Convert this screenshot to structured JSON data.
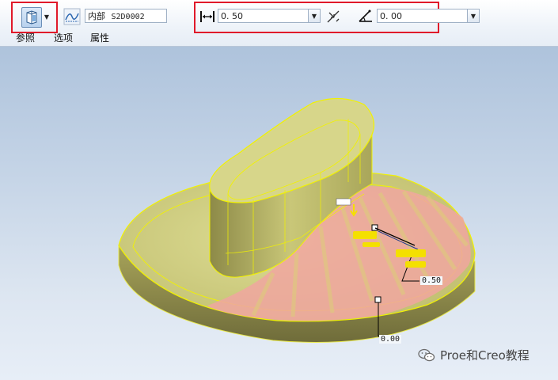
{
  "toolbar": {
    "feature_type_icon": "sweep-blend-surface-icon",
    "section_icon": "sketch-curve-icon",
    "section_combo": {
      "prefix": "内部",
      "name": "S2D0002"
    },
    "thickness_icon": "thickness-dimension-icon",
    "thickness_value": "0. 50",
    "flip_icon": "flip-direction-icon",
    "angle_icon": "angle-icon",
    "angle_value": "0. 00"
  },
  "tabs": [
    "参照",
    "选项",
    "属性"
  ],
  "viewport": {
    "dim_thickness": "0.50",
    "dim_angle": "0.00"
  },
  "watermark": {
    "text": "Proe和Creo教程",
    "icon": "wechat-icon"
  },
  "colors": {
    "highlight": "#e0192a",
    "model_yellow": "#c9c86a",
    "edge_yellow": "#f2f200",
    "preview_pink": "#f0a6a0",
    "background_top": "#aec3dc"
  }
}
